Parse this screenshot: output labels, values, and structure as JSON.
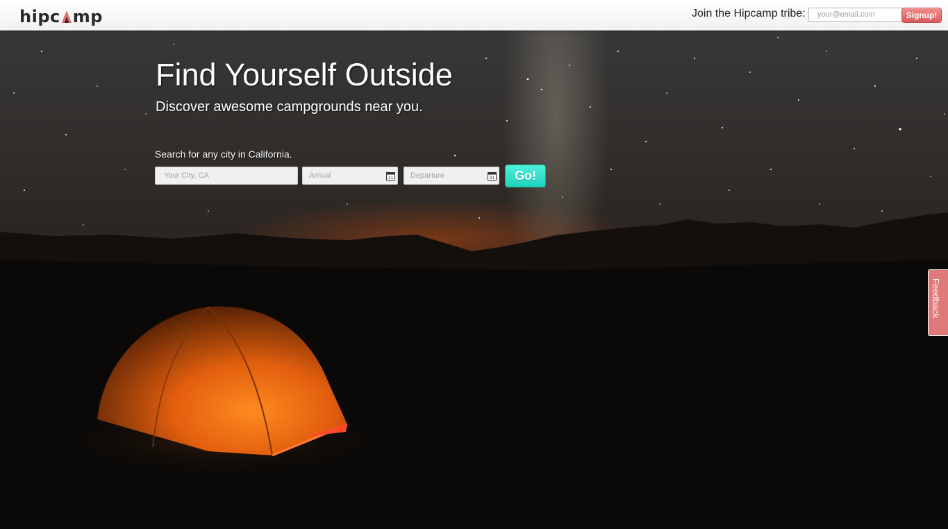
{
  "header": {
    "logo_text_before": "hipc",
    "logo_text_after": "mp",
    "tribe_label": "Join the Hipcamp tribe:",
    "email_placeholder": "your@email.com",
    "signup_label": "Signup!"
  },
  "hero": {
    "headline": "Find Yourself Outside",
    "subheadline": "Discover awesome campgrounds near you.",
    "search_label": "Search for any city in California.",
    "city_placeholder": "Your City, CA",
    "arrival_placeholder": "Arrival",
    "departure_placeholder": "Departure",
    "calendar_day": "31",
    "go_label": "Go!"
  },
  "feedback_label": "Feedback",
  "colors": {
    "brand_red": "#e07a7a",
    "go_teal": "#2fe0c8",
    "tent_orange": "#f07818"
  }
}
